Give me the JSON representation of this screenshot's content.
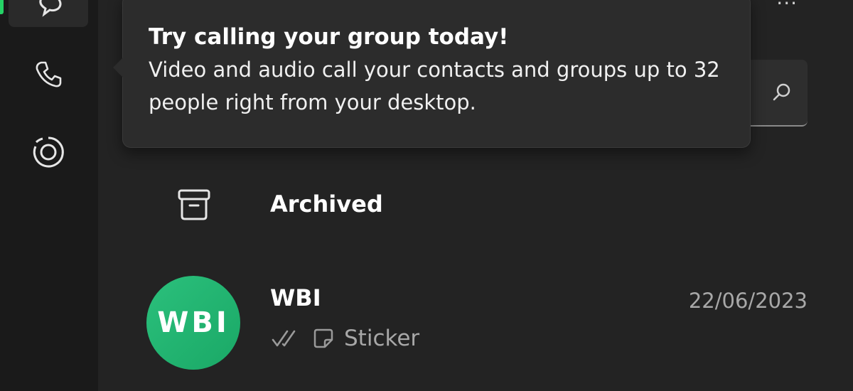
{
  "app": {
    "accent": "#25d366",
    "background": "#202020"
  },
  "rail": {
    "items": [
      {
        "icon": "chats-icon",
        "active": true
      },
      {
        "icon": "phone-icon"
      },
      {
        "icon": "status-icon"
      }
    ]
  },
  "header": {
    "more_label": "···"
  },
  "tooltip": {
    "title": "Try calling your group today!",
    "body": "Video and audio call your contacts and groups up to 32 people right from your desktop."
  },
  "search": {
    "icon": "search-icon"
  },
  "archived": {
    "icon": "archive-icon",
    "label": "Archived"
  },
  "chats": [
    {
      "avatar_text": "WBI",
      "avatar_color": "#22b573",
      "name": "WBI",
      "date": "22/06/2023",
      "status_icon": "double-check-icon",
      "preview_icon": "sticker-icon",
      "preview": "Sticker"
    }
  ]
}
